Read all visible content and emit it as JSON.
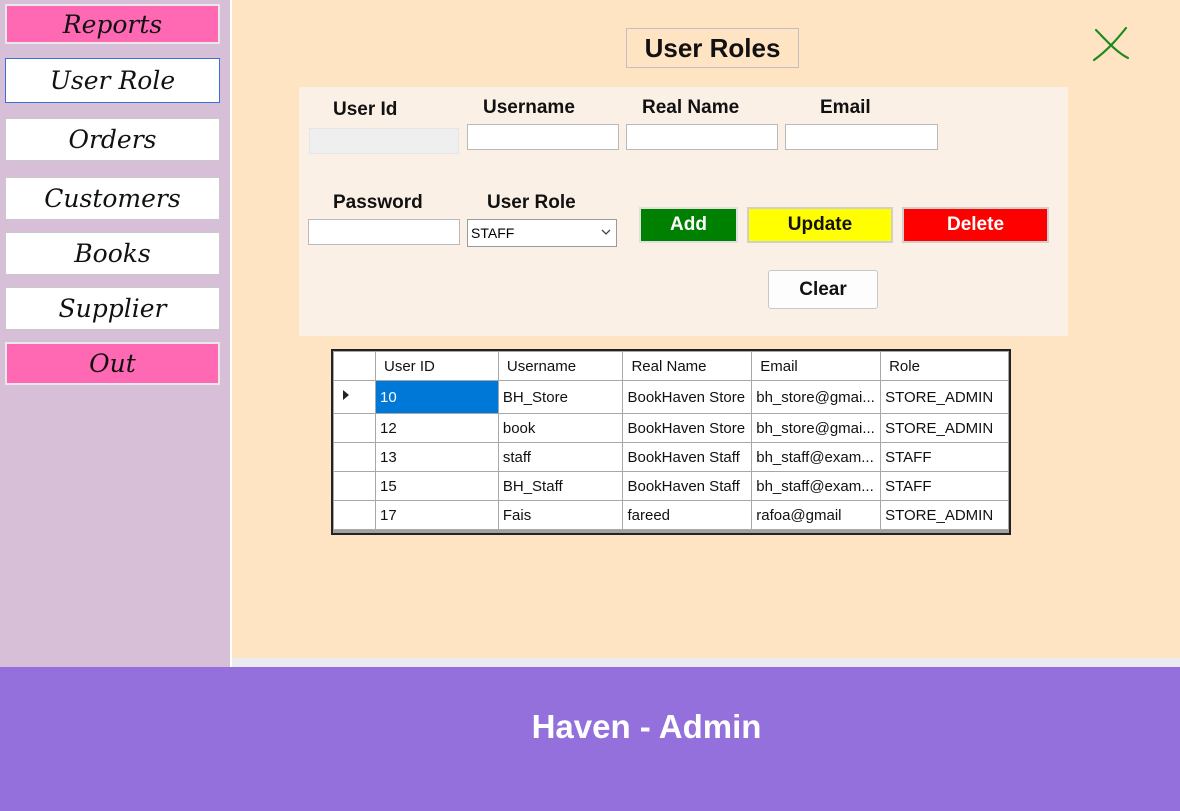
{
  "sidebar": {
    "items": [
      {
        "label": "Reports"
      },
      {
        "label": "User Role"
      },
      {
        "label": "Orders"
      },
      {
        "label": "Customers"
      },
      {
        "label": "Books"
      },
      {
        "label": "Supplier"
      },
      {
        "label": "Out"
      }
    ]
  },
  "page": {
    "title": "User Roles"
  },
  "form": {
    "user_id_label": "User Id",
    "username_label": "Username",
    "real_name_label": "Real Name",
    "email_label": "Email",
    "password_label": "Password",
    "user_role_label": "User Role",
    "user_id_value": "",
    "username_value": "",
    "real_name_value": "",
    "email_value": "",
    "password_value": "",
    "user_role_selected": "STAFF"
  },
  "buttons": {
    "add": "Add",
    "update": "Update",
    "delete": "Delete",
    "clear": "Clear"
  },
  "grid": {
    "headers": [
      "User ID",
      "Username",
      "Real Name",
      "Email",
      "Role"
    ],
    "rows": [
      [
        "10",
        "BH_Store",
        "BookHaven Store",
        "bh_store@gmai...",
        "STORE_ADMIN"
      ],
      [
        "12",
        "book",
        "BookHaven Store",
        "bh_store@gmai...",
        "STORE_ADMIN"
      ],
      [
        "13",
        "staff",
        "BookHaven Staff",
        "bh_staff@exam...",
        "STAFF"
      ],
      [
        "15",
        "BH_Staff",
        "BookHaven Staff",
        "bh_staff@exam...",
        "STAFF"
      ],
      [
        "17",
        "Fais",
        "fareed",
        "rafoa@gmail",
        "STORE_ADMIN"
      ]
    ]
  },
  "footer": {
    "text": "Haven - Admin"
  },
  "colors": {
    "sidebar_bg": "#d8bfd8",
    "main_bg": "#ffe4c4",
    "panel_bg": "#faf0e6",
    "footer_bg": "#9370db",
    "pink_button": "#ff69b4",
    "add_button": "#008000",
    "update_button": "#ffff00",
    "delete_button": "#ff0000",
    "selection": "#0078d7"
  },
  "icons": {
    "close": "close-x-icon",
    "dropdown": "chevron-down-icon",
    "row_indicator": "row-pointer-icon"
  }
}
